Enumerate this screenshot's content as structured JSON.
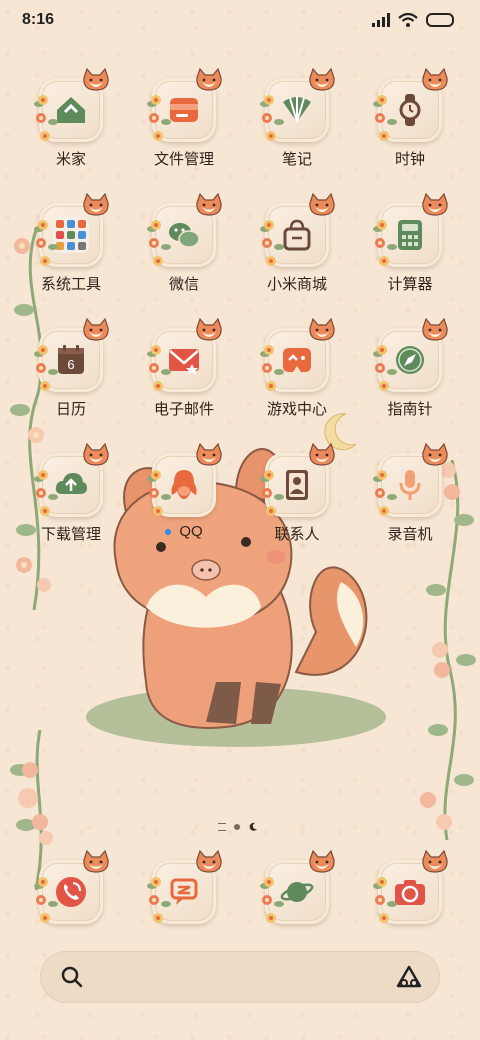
{
  "status_bar": {
    "time": "8:16"
  },
  "apps": [
    {
      "label": "米家",
      "icon": "mihome-icon"
    },
    {
      "label": "文件管理",
      "icon": "folder-icon"
    },
    {
      "label": "笔记",
      "icon": "notes-fan-icon"
    },
    {
      "label": "时钟",
      "icon": "watch-icon"
    },
    {
      "label": "系统工具",
      "icon": "tools-folder-icon"
    },
    {
      "label": "微信",
      "icon": "wechat-icon"
    },
    {
      "label": "小米商城",
      "icon": "shopping-bag-icon"
    },
    {
      "label": "计算器",
      "icon": "calculator-icon"
    },
    {
      "label": "日历",
      "icon": "calendar-icon",
      "calendar_day": "6"
    },
    {
      "label": "电子邮件",
      "icon": "mail-icon"
    },
    {
      "label": "游戏中心",
      "icon": "gamepad-icon"
    },
    {
      "label": "指南针",
      "icon": "compass-icon"
    },
    {
      "label": "下载管理",
      "icon": "cloud-download-icon"
    },
    {
      "label": "QQ",
      "icon": "qq-penguin-icon",
      "has_notification_dot": true
    },
    {
      "label": "联系人",
      "icon": "contacts-icon"
    },
    {
      "label": "录音机",
      "icon": "microphone-icon"
    }
  ],
  "dock": [
    {
      "icon": "phone-icon"
    },
    {
      "icon": "messages-icon"
    },
    {
      "icon": "browser-planet-icon"
    },
    {
      "icon": "camera-icon"
    }
  ],
  "colors": {
    "accent": "#e8693e",
    "green": "#5f8a5c",
    "brown": "#6b4a3a",
    "background": "#f6e6d3",
    "tile": "#f4e4d1"
  }
}
